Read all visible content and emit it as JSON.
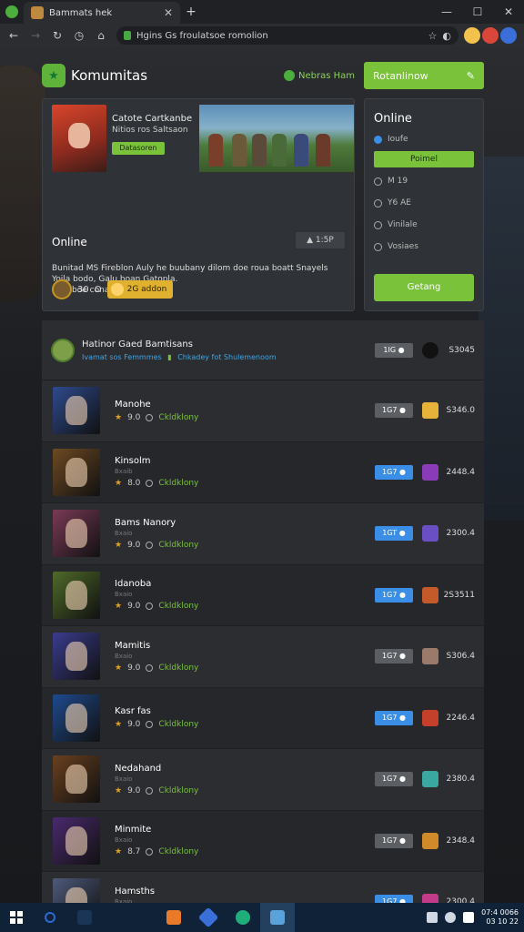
{
  "browser": {
    "tab_title": "Bammats hek",
    "address": "Hgins Gs froulatsoe romolion",
    "window_controls": [
      "—",
      "☐",
      "✕"
    ]
  },
  "header": {
    "brand": "Komumitas",
    "status_text": "Nebras Ham",
    "cta_label": "Rotanlinow",
    "cta_icon": "pin-icon"
  },
  "hero": {
    "banner_title": "Catote Cartkanbe",
    "banner_subtitle": "Nitios ros Saltsaon",
    "banner_button": "Datasoren",
    "online_label": "Online",
    "chip_label": "▲ 1:5P",
    "description": [
      "Bunitad MS Fireblon Auly he buubany dilom doe roua boatt Snayels",
      "Yoila bodo, Galu boan Gatopla.",
      "Pidu boe conan Fodas."
    ],
    "footer_count": "30",
    "footer_pill": "2G addon"
  },
  "side": {
    "title": "Online",
    "options": [
      {
        "label": "Ioufe",
        "style": "blue"
      },
      {
        "label": "Poimel",
        "style": "button"
      },
      {
        "label": "M 19",
        "style": "radio"
      },
      {
        "label": "Y6 AE",
        "style": "radio"
      },
      {
        "label": "Vinilale",
        "style": "radio"
      },
      {
        "label": "Vosiaes",
        "style": "radio"
      }
    ],
    "cta_label": "Getang"
  },
  "list_header": {
    "title": "Hatinor Gaed Bamtisans",
    "link_left": "Ivamat sos Femmmes",
    "link_right": "Chkadey fot Shulemenoom",
    "badge": "1IG ●",
    "price": "S3045"
  },
  "rows": [
    {
      "name": "Manohe",
      "sub": "",
      "rating": "9.0",
      "status": "Ckldklony",
      "badge": "1G7 ●",
      "badge_style": "grey",
      "price": "S346.0",
      "thumb": "#2e4a8e",
      "icon": "#e6b23a"
    },
    {
      "name": "Kinsolm",
      "sub": "Bxaib",
      "rating": "8.0",
      "status": "Ckldklony",
      "badge": "1G7 ●",
      "badge_style": "blue",
      "price": "2448.4",
      "thumb": "#6d4a22",
      "icon": "#8a3bb7"
    },
    {
      "name": "Bams Nanory",
      "sub": "Bxaio",
      "rating": "9.0",
      "status": "Ckldklony",
      "badge": "1GT ●",
      "badge_style": "blue",
      "price": "2300.4",
      "thumb": "#7a3a56",
      "icon": "#6a4ec4"
    },
    {
      "name": "Idanoba",
      "sub": "Bxaio",
      "rating": "9.0",
      "status": "Ckldklony",
      "badge": "1G7 ●",
      "badge_style": "blue",
      "price": "2S3511",
      "thumb": "#4f6a2a",
      "icon": "#c45a2a"
    },
    {
      "name": "Mamitis",
      "sub": "Bxaio",
      "rating": "9.0",
      "status": "Ckldklony",
      "badge": "1G7 ●",
      "badge_style": "grey",
      "price": "S306.4",
      "thumb": "#3a3c8e",
      "icon": "#9a7a6a"
    },
    {
      "name": "Kasr fas",
      "sub": "",
      "rating": "9.0",
      "status": "Ckldklony",
      "badge": "1G7 ●",
      "badge_style": "blue",
      "price": "2246.4",
      "thumb": "#1e4a8e",
      "icon": "#c4402a"
    },
    {
      "name": "Nedahand",
      "sub": "Bxaio",
      "rating": "9.0",
      "status": "Ckldklony",
      "badge": "1G7 ●",
      "badge_style": "grey",
      "price": "2380.4",
      "thumb": "#6a4020",
      "icon": "#3aa7a0"
    },
    {
      "name": "Minmite",
      "sub": "Bxaio",
      "rating": "8.7",
      "status": "Ckldklony",
      "badge": "1G7 ●",
      "badge_style": "grey",
      "price": "2348.4",
      "thumb": "#4a2a6e",
      "icon": "#d08a2a"
    },
    {
      "name": "Hamsths",
      "sub": "Bxaio",
      "rating": "9.0",
      "status": "Ckldklony",
      "badge": "1G7 ●",
      "badge_style": "blue",
      "price": "2300.4",
      "thumb": "#4e5a7a",
      "icon": "#c43a8a"
    }
  ],
  "taskbar": {
    "clock_time": "07:4 0066",
    "clock_date": "03 10 22"
  }
}
